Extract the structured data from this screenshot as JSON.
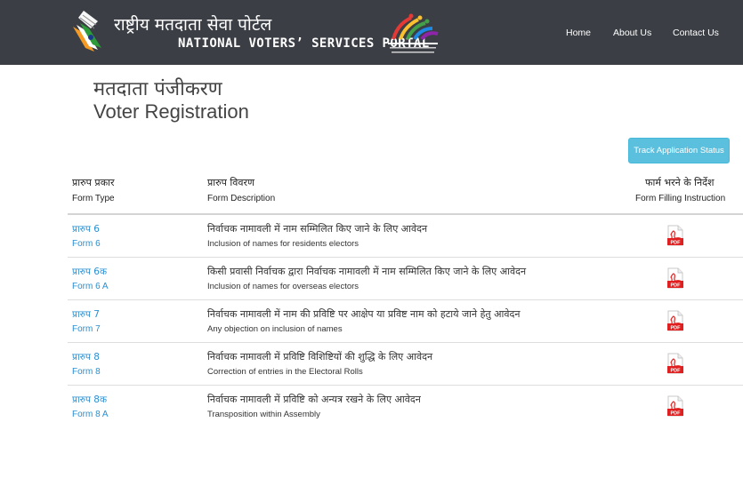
{
  "header": {
    "brand_hindi": "राष्ट्रीय मतदाता सेवा पोर्टल",
    "brand_english": "NATIONAL VOTERS’ SERVICES PORTAL",
    "nav": [
      "Home",
      "About Us",
      "Contact Us"
    ],
    "logo_icon": "ballot-fingerprint-logo",
    "campaign_icon": "national-voters-day-logo"
  },
  "page": {
    "title_hindi": "मतदाता पंजीकरण",
    "title_english": "Voter Registration",
    "track_button": "Track Application Status"
  },
  "table": {
    "headers": {
      "type_hindi": "प्रारुप प्रकार",
      "type_english": "Form Type",
      "desc_hindi": "प्रारुप विवरण",
      "desc_english": "Form Description",
      "instr_hindi": "फार्म भरने के निर्देश",
      "instr_english": "Form Filling Instruction"
    },
    "rows": [
      {
        "type_hindi": "प्रारुप 6",
        "type_english": "Form 6",
        "desc_hindi": "निर्वाचक नामावली में नाम सम्मिलित किए जाने के लिए आवेदन",
        "desc_english": "Inclusion of names for residents electors",
        "pdf_label": "PDF"
      },
      {
        "type_hindi": "प्रारुप 6क",
        "type_english": "Form 6 A",
        "desc_hindi": "किसी प्रवासी निर्वाचक द्वारा निर्वाचक नामावली में नाम सम्मिलित किए जाने के लिए आवेदन",
        "desc_english": "Inclusion of names for overseas electors",
        "pdf_label": "PDF"
      },
      {
        "type_hindi": "प्रारुप 7",
        "type_english": "Form 7",
        "desc_hindi": "निर्वाचक नामावली में नाम की प्रविष्टि पर आक्षेप या प्रविष्ट नाम को हटाये जाने हेतु आवेदन",
        "desc_english": "Any objection on inclusion of names",
        "pdf_label": "PDF"
      },
      {
        "type_hindi": "प्रारुप 8",
        "type_english": "Form 8",
        "desc_hindi": "निर्वाचक नामावली में प्रविष्टि विशिष्टियों की शुद्धि के लिए आवेदन",
        "desc_english": "Correction of entries in the Electoral Rolls",
        "pdf_label": "PDF"
      },
      {
        "type_hindi": "प्रारुप 8क",
        "type_english": "Form 8 A",
        "desc_hindi": "निर्वाचक नामावली में प्रविष्टि को अन्यत्र रखने के लिए आवेदन",
        "desc_english": "Transposition within Assembly",
        "pdf_label": "PDF"
      }
    ]
  },
  "colors": {
    "navbar": "#3b3f45",
    "link": "#2a8fd0",
    "button": "#5bc0de",
    "pdf": "#e02020"
  }
}
